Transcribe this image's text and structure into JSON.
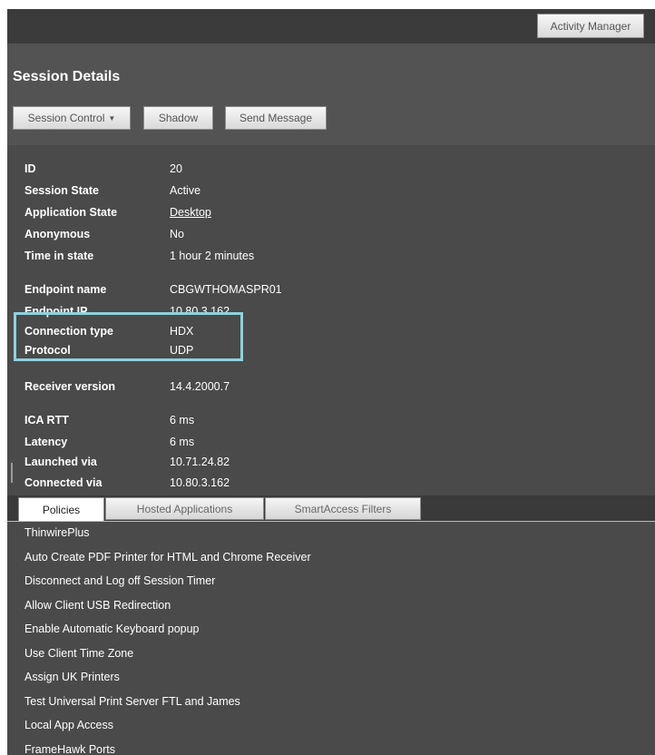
{
  "header": {
    "activity_manager": "Activity Manager"
  },
  "title": "Session Details",
  "toolbar": {
    "session_control": "Session Control",
    "shadow": "Shadow",
    "send_message": "Send Message"
  },
  "details": [
    {
      "label": "ID",
      "value": "20"
    },
    {
      "label": "Session State",
      "value": "Active"
    },
    {
      "label": "Application State",
      "value": "Desktop"
    },
    {
      "label": "Anonymous",
      "value": "No"
    },
    {
      "label": "Time in state",
      "value": "1 hour 2 minutes"
    },
    {
      "label": "Endpoint name",
      "value": "CBGWTHOMASPR01"
    },
    {
      "label": "Endpoint IP",
      "value": "10.80.3.162"
    },
    {
      "label": "Connection type",
      "value": "HDX"
    },
    {
      "label": "Protocol",
      "value": "UDP"
    },
    {
      "label": "Receiver version",
      "value": "14.4.2000.7"
    },
    {
      "label": "ICA RTT",
      "value": "6 ms"
    },
    {
      "label": "Latency",
      "value": "6 ms"
    },
    {
      "label": "Launched via",
      "value": "10.71.24.82"
    },
    {
      "label": "Connected via",
      "value": "10.80.3.162"
    }
  ],
  "tabs": [
    {
      "label": "Policies"
    },
    {
      "label": "Hosted Applications"
    },
    {
      "label": "SmartAccess Filters"
    }
  ],
  "policies": [
    "ThinwirePlus",
    "Auto Create PDF Printer for HTML and Chrome Receiver",
    "Disconnect and Log off Session Timer",
    "Allow Client USB Redirection",
    "Enable Automatic Keyboard popup",
    "Use Client Time Zone",
    "Assign UK Printers",
    "Test Universal Print Server FTL and James",
    "Local App Access",
    "FrameHawk Ports"
  ],
  "colors": {
    "panel": "#4a4a4a",
    "header": "#3b3b3b",
    "highlight": "#8fd1dd"
  }
}
